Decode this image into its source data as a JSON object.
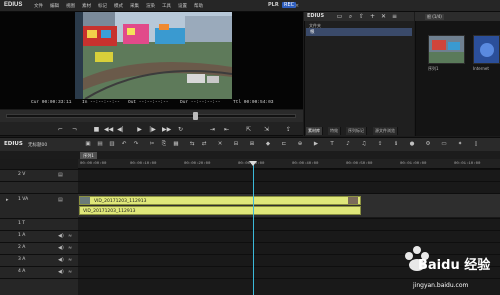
{
  "app": {
    "name": "EDIUS",
    "menu": [
      "文件",
      "编辑",
      "视图",
      "素材",
      "标记",
      "模式",
      "采集",
      "渲染",
      "工具",
      "设置",
      "帮助"
    ],
    "plr": "PLR",
    "rec": "REC"
  },
  "preview": {
    "cur": "Cur 00:00:33:11",
    "in": "In --:--:--:--",
    "out": "Out --:--:--:--",
    "dur": "Dur --:--:--:--",
    "ttl": "Ttl 00:00:54:03"
  },
  "bin": {
    "title": "EDIUS",
    "tree_label": "文件夹",
    "folder": "根",
    "tabs": [
      "素材库",
      "特效",
      "序列标记",
      "源文件浏览"
    ],
    "asset_tab": "根 (1/4)",
    "assets": [
      {
        "label": "序列1"
      },
      {
        "label": "Internet"
      }
    ]
  },
  "timeline": {
    "logo": "EDIUS",
    "sequence_name": "无标题00",
    "tab": "序列1",
    "ruler": [
      "00:00:00:00",
      "00:00:10:00",
      "00:00:20:00",
      "00:00:30:00",
      "00:00:40:00",
      "00:00:50:00",
      "00:01:00:00",
      "00:01:10:00"
    ],
    "tracks": [
      {
        "label": "2 V"
      },
      {
        "label": "1 VA"
      },
      {
        "label": "1 T"
      },
      {
        "label": "1 A"
      },
      {
        "label": "2 A"
      },
      {
        "label": "3 A"
      },
      {
        "label": "4 A"
      }
    ],
    "clips": {
      "video": "VID_20171203_112913",
      "audio": "VID_20171203_112913"
    }
  },
  "watermark": {
    "brand": "Baidu 经验",
    "url": "jingyan.baidu.com"
  },
  "colors": {
    "clip": "#dfe77a",
    "playhead": "#3bb9d8",
    "accent": "#2f5fbf"
  }
}
